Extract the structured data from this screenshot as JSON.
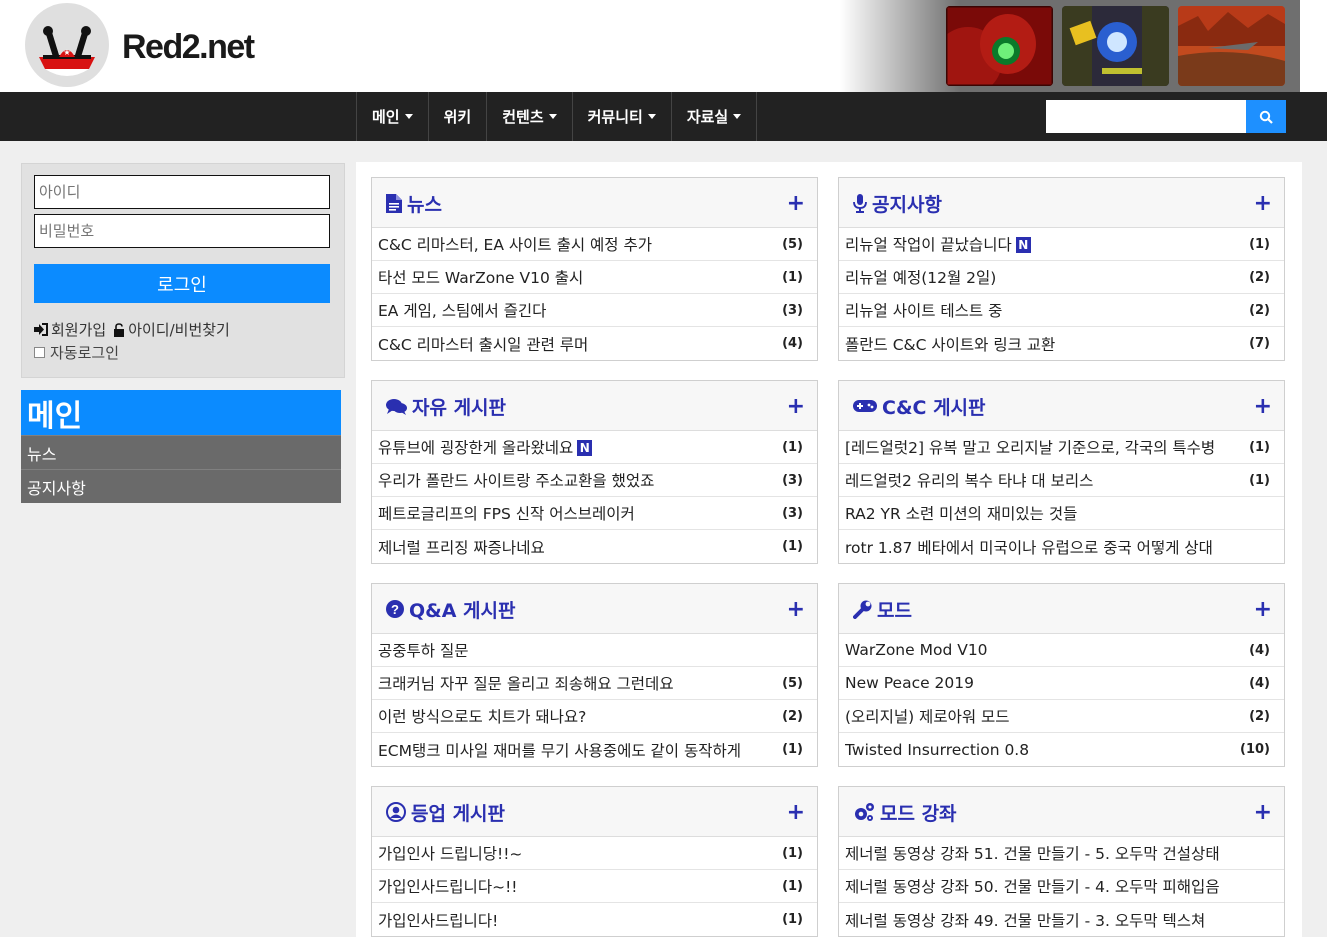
{
  "site": {
    "logo_text": "Red2.net"
  },
  "nav": {
    "items": [
      {
        "label": "메인",
        "dropdown": true
      },
      {
        "label": "위키",
        "dropdown": false
      },
      {
        "label": "컨텐츠",
        "dropdown": true
      },
      {
        "label": "커뮤니티",
        "dropdown": true
      },
      {
        "label": "자료실",
        "dropdown": true
      }
    ],
    "search_placeholder": "",
    "search_icon": "search-icon"
  },
  "login": {
    "id_placeholder": "아이디",
    "pw_placeholder": "비밀번호",
    "button": "로그인",
    "signup": "회원가입",
    "find": "아이디/비번찾기",
    "auto_login": "자동로그인"
  },
  "sidebar": {
    "title": "메인",
    "items": [
      "뉴스",
      "공지사항"
    ]
  },
  "boards": [
    {
      "title": "뉴스",
      "icon": "document-icon",
      "posts": [
        {
          "title": "C&C 리마스터, EA 사이트 출시 예정 추가",
          "count": "(5)",
          "new": false
        },
        {
          "title": "타선 모드 WarZone V10 출시",
          "count": "(1)",
          "new": false
        },
        {
          "title": "EA 게임, 스팀에서 즐긴다",
          "count": "(3)",
          "new": false
        },
        {
          "title": "C&C 리마스터 출시일 관련 루머",
          "count": "(4)",
          "new": false
        }
      ]
    },
    {
      "title": "공지사항",
      "icon": "microphone-icon",
      "posts": [
        {
          "title": "리뉴얼 작업이 끝났습니다",
          "count": "(1)",
          "new": true
        },
        {
          "title": "리뉴얼 예정(12월 2일)",
          "count": "(2)",
          "new": false
        },
        {
          "title": "리뉴얼 사이트 테스트 중",
          "count": "(2)",
          "new": false
        },
        {
          "title": "폴란드 C&C 사이트와 링크 교환",
          "count": "(7)",
          "new": false
        }
      ]
    },
    {
      "title": "자유 게시판",
      "icon": "comments-icon",
      "posts": [
        {
          "title": "유튜브에 굉장한게 올라왔네요",
          "count": "(1)",
          "new": true
        },
        {
          "title": "우리가 폴란드 사이트랑 주소교환을 했었죠",
          "count": "(3)",
          "new": false
        },
        {
          "title": "페트로글리프의 FPS 신작 어스브레이커",
          "count": "(3)",
          "new": false
        },
        {
          "title": "제너럴 프리징 짜증나네요",
          "count": "(1)",
          "new": false
        }
      ]
    },
    {
      "title": "C&C 게시판",
      "icon": "gamepad-icon",
      "posts": [
        {
          "title": "[레드얼럿2] 유복 말고 오리지날 기준으로, 각국의 특수병",
          "count": "(1)",
          "new": false
        },
        {
          "title": "레드얼럿2 유리의 복수 타냐 대 보리스",
          "count": "(1)",
          "new": false
        },
        {
          "title": "RA2 YR 소련 미션의 재미있는 것들",
          "count": "",
          "new": false
        },
        {
          "title": "rotr 1.87 베타에서 미국이나 유럽으로 중국 어떻게 상대",
          "count": "",
          "new": false
        }
      ]
    },
    {
      "title": "Q&A 게시판",
      "icon": "question-circle-icon",
      "posts": [
        {
          "title": "공중투하 질문",
          "count": "",
          "new": false
        },
        {
          "title": "크래커님 자꾸 질문 올리고 죄송해요 그런데요",
          "count": "(5)",
          "new": false
        },
        {
          "title": "이런 방식으로도 치트가 돼나요?",
          "count": "(2)",
          "new": false
        },
        {
          "title": "ECM탱크 미사일 재머를 무기 사용중에도 같이 동작하게",
          "count": "(1)",
          "new": false
        }
      ]
    },
    {
      "title": "모드",
      "icon": "wrench-icon",
      "posts": [
        {
          "title": "WarZone Mod V10",
          "count": "(4)",
          "new": false
        },
        {
          "title": "New Peace 2019",
          "count": "(4)",
          "new": false
        },
        {
          "title": "(오리지널) 제로아워 모드",
          "count": "(2)",
          "new": false
        },
        {
          "title": "Twisted Insurrection 0.8",
          "count": "(10)",
          "new": false
        }
      ]
    },
    {
      "title": "등업 게시판",
      "icon": "user-circle-icon",
      "posts": [
        {
          "title": "가입인사 드립니당!!~",
          "count": "(1)",
          "new": false
        },
        {
          "title": "가입인사드립니다~!!",
          "count": "(1)",
          "new": false
        },
        {
          "title": "가입인사드립니다!",
          "count": "(1)",
          "new": false
        }
      ]
    },
    {
      "title": "모드 강좌",
      "icon": "cogs-icon",
      "posts": [
        {
          "title": "제너럴 동영상 강좌 51. 건물 만들기 - 5. 오두막 건설상태",
          "count": "",
          "new": false
        },
        {
          "title": "제너럴 동영상 강좌 50. 건물 만들기 - 4. 오두막 피해입음",
          "count": "",
          "new": false
        },
        {
          "title": "제너럴 동영상 강좌 49. 건물 만들기 - 3. 오두막 텍스쳐",
          "count": "",
          "new": false
        }
      ]
    }
  ],
  "new_badge": "N",
  "more_symbol": "+",
  "colors": {
    "accent": "#0b8bff",
    "board_title": "#2a2fb0",
    "nav_bg": "#222222",
    "side_item": "#6a6a6a"
  }
}
